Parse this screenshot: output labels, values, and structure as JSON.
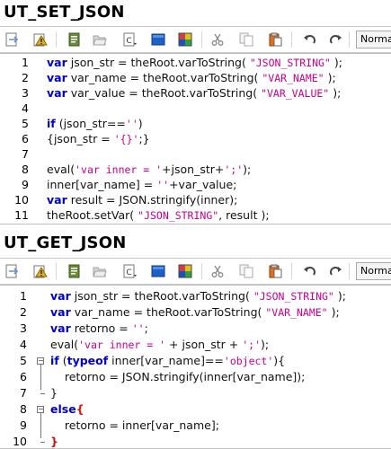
{
  "sections": [
    {
      "title": "UT_SET_JSON",
      "toolbar": {
        "format_select": "Normal"
      },
      "lines": [
        {
          "n": "1",
          "parts": [
            [
              "kw",
              "var"
            ],
            [
              "t",
              " json_str = theRoot.varToString( "
            ],
            [
              "str",
              "\"JSON_STRING\""
            ],
            [
              "t",
              " );"
            ]
          ]
        },
        {
          "n": "2",
          "parts": [
            [
              "kw",
              "var"
            ],
            [
              "t",
              " var_name = theRoot.varToString( "
            ],
            [
              "str",
              "\"VAR_NAME\""
            ],
            [
              "t",
              " );"
            ]
          ]
        },
        {
          "n": "3",
          "parts": [
            [
              "kw",
              "var"
            ],
            [
              "t",
              " var_value = theRoot.varToString( "
            ],
            [
              "str",
              "\"VAR_VALUE\""
            ],
            [
              "t",
              " );"
            ]
          ]
        },
        {
          "n": "4",
          "parts": []
        },
        {
          "n": "5",
          "parts": [
            [
              "kw",
              "if"
            ],
            [
              "t",
              " (json_str=="
            ],
            [
              "str",
              "''"
            ],
            [
              "t",
              ")"
            ]
          ]
        },
        {
          "n": "6",
          "parts": [
            [
              "t",
              "{json_str = "
            ],
            [
              "str",
              "'{}'"
            ],
            [
              "t",
              ";}"
            ]
          ]
        },
        {
          "n": "7",
          "parts": []
        },
        {
          "n": "8",
          "parts": [
            [
              "t",
              "eval("
            ],
            [
              "str",
              "'var inner = '"
            ],
            [
              "t",
              "+json_str+"
            ],
            [
              "str",
              "';'"
            ],
            [
              "t",
              ");"
            ]
          ]
        },
        {
          "n": "9",
          "parts": [
            [
              "t",
              "inner[var_name] = "
            ],
            [
              "str",
              "''"
            ],
            [
              "t",
              "+var_value;"
            ]
          ]
        },
        {
          "n": "10",
          "parts": [
            [
              "kw",
              "var"
            ],
            [
              "t",
              " result = JSON.stringify(inner);"
            ]
          ]
        },
        {
          "n": "11",
          "parts": [
            [
              "t",
              "theRoot.setVar( "
            ],
            [
              "str",
              "\"JSON_STRING\""
            ],
            [
              "t",
              ", result );"
            ]
          ]
        }
      ]
    },
    {
      "title": "UT_GET_JSON",
      "toolbar": {
        "format_select": "Normal"
      },
      "lines": [
        {
          "n": "1",
          "parts": [
            [
              "kw",
              "var"
            ],
            [
              "t",
              " json_str = theRoot.varToString( "
            ],
            [
              "str",
              "\"JSON_STRING\""
            ],
            [
              "t",
              " );"
            ]
          ]
        },
        {
          "n": "2",
          "parts": [
            [
              "kw",
              "var"
            ],
            [
              "t",
              " var_name = theRoot.varToString( "
            ],
            [
              "str",
              "\"VAR_NAME\""
            ],
            [
              "t",
              " );"
            ]
          ]
        },
        {
          "n": "3",
          "parts": [
            [
              "kw",
              "var"
            ],
            [
              "t",
              " retorno = "
            ],
            [
              "str",
              "''"
            ],
            [
              "t",
              ";"
            ]
          ]
        },
        {
          "n": "4",
          "parts": [
            [
              "t",
              "eval("
            ],
            [
              "str",
              "'var inner = '"
            ],
            [
              "t",
              " + json_str + "
            ],
            [
              "str",
              "';'"
            ],
            [
              "t",
              ");"
            ]
          ]
        },
        {
          "n": "5",
          "parts": [
            [
              "kw",
              "if"
            ],
            [
              "t",
              " ("
            ],
            [
              "kw",
              "typeof"
            ],
            [
              "t",
              " inner[var_name]=="
            ],
            [
              "str",
              "'object'"
            ],
            [
              "t",
              "){"
            ]
          ]
        },
        {
          "n": "6",
          "parts": [
            [
              "t",
              "    retorno = JSON.stringify(inner[var_name]);"
            ]
          ]
        },
        {
          "n": "7",
          "parts": [
            [
              "t",
              "}"
            ]
          ]
        },
        {
          "n": "8",
          "parts": [
            [
              "kw",
              "else"
            ],
            [
              "red",
              "{"
            ]
          ]
        },
        {
          "n": "9",
          "parts": [
            [
              "t",
              "    retorno = inner[var_name];"
            ]
          ]
        },
        {
          "n": "10",
          "parts": [
            [
              "red",
              "}"
            ]
          ]
        }
      ]
    }
  ],
  "toolbar_icons": [
    {
      "name": "insert-tag-icon",
      "color": "#6a8ecf"
    },
    {
      "name": "warning-icon",
      "color": "#e0b020"
    },
    {
      "name": "snippet-icon",
      "color": "#6a8a3a"
    },
    {
      "name": "open-folder-icon",
      "color": "#a0a0a0"
    },
    {
      "name": "page-c-icon",
      "color": "#777777"
    },
    {
      "name": "blue-folder-icon",
      "color": "#1f5fc8"
    },
    {
      "name": "palette-icon",
      "color": "#d04040"
    },
    {
      "name": "cut-icon",
      "color": "#888888"
    },
    {
      "name": "copy-icon",
      "color": "#aaaaaa"
    },
    {
      "name": "paste-icon",
      "color": "#e07020"
    },
    {
      "name": "undo-icon",
      "color": "#444444"
    },
    {
      "name": "redo-icon",
      "color": "#444444"
    }
  ]
}
